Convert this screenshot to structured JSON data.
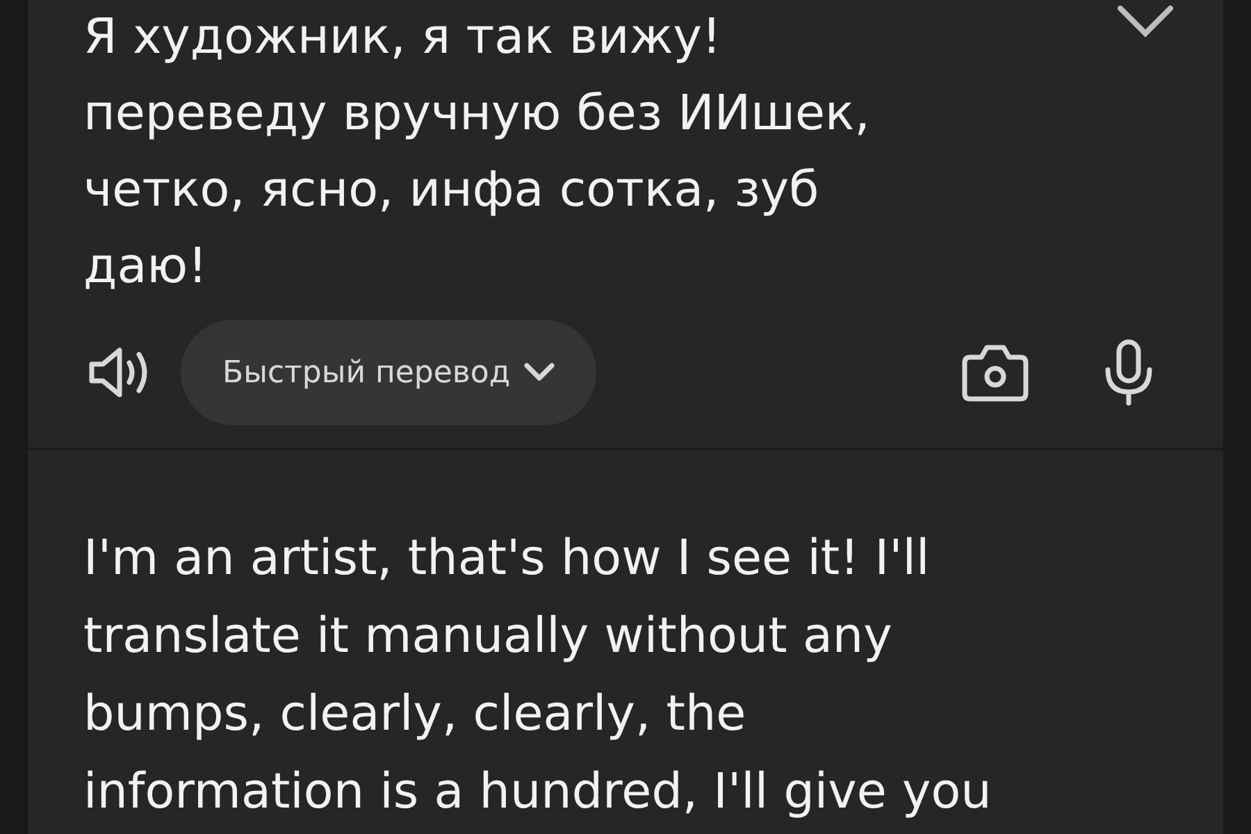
{
  "source": {
    "lines": [
      "Я художник, я так вижу!",
      "переведу вручную без ИИшек,",
      "четко, ясно, инфа сотка, зуб",
      "даю!"
    ]
  },
  "toolbar": {
    "mode_label": "Быстрый перевод"
  },
  "translation": {
    "lines": [
      "I'm an artist, that's how I see it! I'll",
      "translate it manually without any",
      "bumps, clearly, clearly, the",
      "information is a hundred, I'll give you"
    ]
  }
}
